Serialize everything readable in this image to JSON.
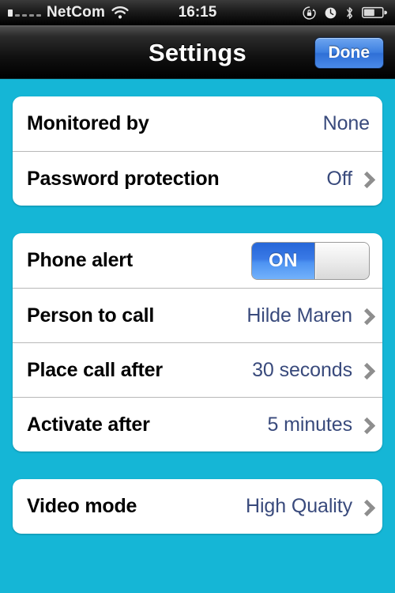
{
  "statusbar": {
    "carrier": "NetCom",
    "time": "16:15",
    "signal_bars_filled": 1,
    "signal_bars_total": 5,
    "icons": [
      "wifi-icon",
      "rotation-lock-icon",
      "alarm-clock-icon",
      "bluetooth-icon",
      "battery-icon"
    ],
    "battery_level_percent": 55
  },
  "navbar": {
    "title": "Settings",
    "done_label": "Done",
    "accent_color": "#3d7fe0"
  },
  "theme": {
    "background_color": "#15b6d6",
    "card_color": "#ffffff",
    "label_color": "#000000",
    "value_color": "#394a7c",
    "chevron_color": "#8e8e8e",
    "toggle_on_color": "#3a7ae6"
  },
  "groups": [
    {
      "rows": [
        {
          "label": "Monitored by",
          "value": "None",
          "chevron": false,
          "type": "value"
        },
        {
          "label": "Password protection",
          "value": "Off",
          "chevron": true,
          "type": "value"
        }
      ]
    },
    {
      "rows": [
        {
          "label": "Phone alert",
          "value": "ON",
          "chevron": false,
          "type": "toggle",
          "state": "on"
        },
        {
          "label": "Person to call",
          "value": "Hilde Maren",
          "chevron": true,
          "type": "value"
        },
        {
          "label": "Place call after",
          "value": "30 seconds",
          "chevron": true,
          "type": "value"
        },
        {
          "label": "Activate after",
          "value": "5 minutes",
          "chevron": true,
          "type": "value"
        }
      ]
    },
    {
      "rows": [
        {
          "label": "Video mode",
          "value": "High Quality",
          "chevron": true,
          "type": "value"
        }
      ]
    }
  ]
}
